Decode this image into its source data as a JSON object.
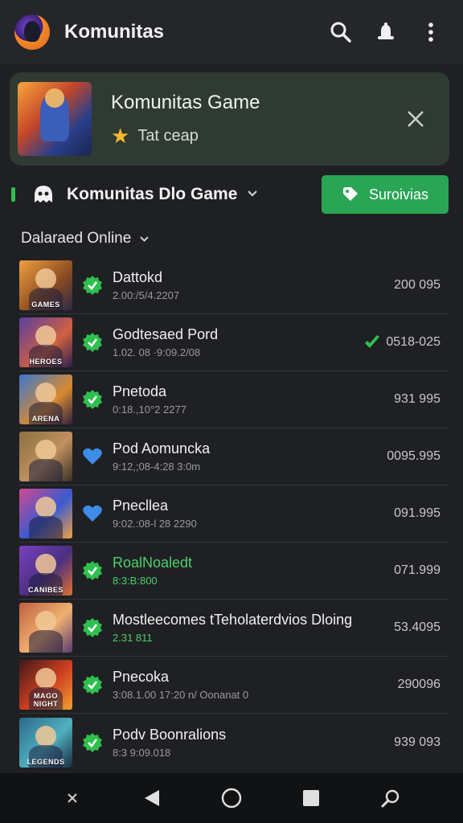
{
  "app": {
    "title": "Komunitas",
    "icons": [
      "search-icon",
      "notification-bell-icon",
      "overflow-menu-icon"
    ]
  },
  "promo": {
    "title": "Komunitas Game",
    "subtitle": "Tat ceap",
    "star_icon": "star-icon",
    "close_icon": "close-icon"
  },
  "community": {
    "name": "Komunitas Dlo Game",
    "subscribe_label": "Suroivias",
    "accent": "#2aa556"
  },
  "filter": {
    "label": "Dalaraed Online"
  },
  "games": [
    {
      "title": "Dattokd",
      "meta": "2.00:/5/4.2207",
      "value": "200 095",
      "status": "green-check",
      "value_check": false,
      "thumb_tag": "GAMES"
    },
    {
      "title": "Godtesaed Pord",
      "meta": "1.02. 08 ·9:09.2/08",
      "value": "0518-025",
      "status": "green-check",
      "value_check": true,
      "thumb_tag": "HEROES"
    },
    {
      "title": "Pnetoda",
      "meta": "0:18.,10°2 2277",
      "value": "931 995",
      "status": "green-check",
      "value_check": false,
      "thumb_tag": "ARENA"
    },
    {
      "title": "Pod Aomuncka",
      "meta": "9:12,;08-4:28 3:0m",
      "value": "0095.995",
      "status": "blue-heart",
      "value_check": false,
      "thumb_tag": ""
    },
    {
      "title": "Pnecllea",
      "meta": "9:02.:08-l 28 2290",
      "value": "091.995",
      "status": "blue-heart",
      "value_check": false,
      "thumb_tag": ""
    },
    {
      "title": "RoalNoaledt",
      "meta": "8:3:B:800",
      "value": "071.999",
      "status": "green-check",
      "value_check": false,
      "thumb_tag": "CANIBES",
      "highlight": true
    },
    {
      "title": "Mostleecomes tTeholaterdvios Dloing",
      "meta": "2.31 811",
      "value": "53.4095",
      "status": "green-check",
      "value_check": false,
      "thumb_tag": "",
      "meta_green": true
    },
    {
      "title": "Pnecoka",
      "meta": "3:08.1.00 17:20 n/ Oonanat 0",
      "value": "290096",
      "status": "green-check",
      "value_check": false,
      "thumb_tag": "MAGO NIGHT"
    },
    {
      "title": "Podv Boonralions",
      "meta": "8:3 9:09.018",
      "value": "939 093",
      "status": "green-check",
      "value_check": false,
      "thumb_tag": "LEGENDS"
    }
  ],
  "nav": [
    "back-chevron-icon",
    "back-triangle-icon",
    "home-circle-icon",
    "recents-square-icon",
    "search-icon"
  ],
  "colors": {
    "background": "#1f2023",
    "appbar": "#25262a",
    "promo_card": "#2f3a33",
    "check_green": "#2fbf4f",
    "heart_blue": "#3d8de8"
  }
}
